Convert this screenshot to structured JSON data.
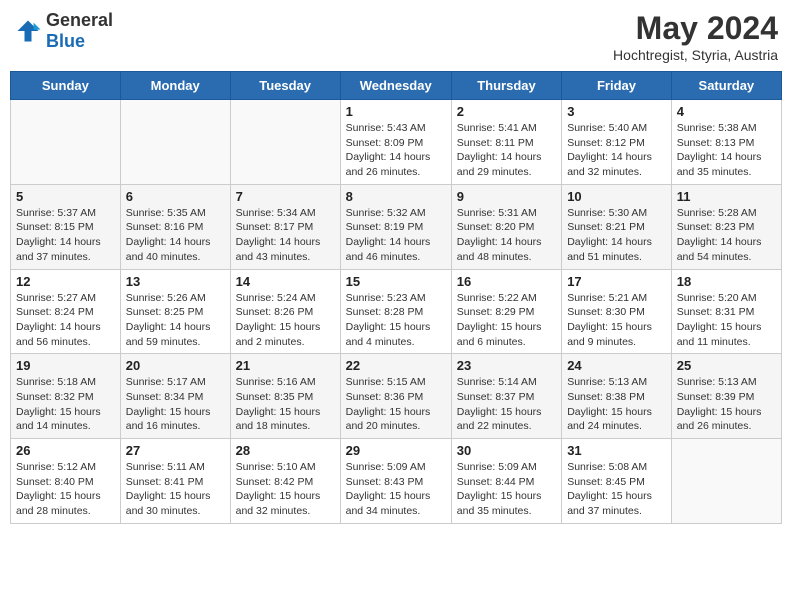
{
  "header": {
    "logo_general": "General",
    "logo_blue": "Blue",
    "month_year": "May 2024",
    "location": "Hochtregist, Styria, Austria"
  },
  "weekdays": [
    "Sunday",
    "Monday",
    "Tuesday",
    "Wednesday",
    "Thursday",
    "Friday",
    "Saturday"
  ],
  "weeks": [
    [
      {
        "day": "",
        "info": ""
      },
      {
        "day": "",
        "info": ""
      },
      {
        "day": "",
        "info": ""
      },
      {
        "day": "1",
        "info": "Sunrise: 5:43 AM\nSunset: 8:09 PM\nDaylight: 14 hours\nand 26 minutes."
      },
      {
        "day": "2",
        "info": "Sunrise: 5:41 AM\nSunset: 8:11 PM\nDaylight: 14 hours\nand 29 minutes."
      },
      {
        "day": "3",
        "info": "Sunrise: 5:40 AM\nSunset: 8:12 PM\nDaylight: 14 hours\nand 32 minutes."
      },
      {
        "day": "4",
        "info": "Sunrise: 5:38 AM\nSunset: 8:13 PM\nDaylight: 14 hours\nand 35 minutes."
      }
    ],
    [
      {
        "day": "5",
        "info": "Sunrise: 5:37 AM\nSunset: 8:15 PM\nDaylight: 14 hours\nand 37 minutes."
      },
      {
        "day": "6",
        "info": "Sunrise: 5:35 AM\nSunset: 8:16 PM\nDaylight: 14 hours\nand 40 minutes."
      },
      {
        "day": "7",
        "info": "Sunrise: 5:34 AM\nSunset: 8:17 PM\nDaylight: 14 hours\nand 43 minutes."
      },
      {
        "day": "8",
        "info": "Sunrise: 5:32 AM\nSunset: 8:19 PM\nDaylight: 14 hours\nand 46 minutes."
      },
      {
        "day": "9",
        "info": "Sunrise: 5:31 AM\nSunset: 8:20 PM\nDaylight: 14 hours\nand 48 minutes."
      },
      {
        "day": "10",
        "info": "Sunrise: 5:30 AM\nSunset: 8:21 PM\nDaylight: 14 hours\nand 51 minutes."
      },
      {
        "day": "11",
        "info": "Sunrise: 5:28 AM\nSunset: 8:23 PM\nDaylight: 14 hours\nand 54 minutes."
      }
    ],
    [
      {
        "day": "12",
        "info": "Sunrise: 5:27 AM\nSunset: 8:24 PM\nDaylight: 14 hours\nand 56 minutes."
      },
      {
        "day": "13",
        "info": "Sunrise: 5:26 AM\nSunset: 8:25 PM\nDaylight: 14 hours\nand 59 minutes."
      },
      {
        "day": "14",
        "info": "Sunrise: 5:24 AM\nSunset: 8:26 PM\nDaylight: 15 hours\nand 2 minutes."
      },
      {
        "day": "15",
        "info": "Sunrise: 5:23 AM\nSunset: 8:28 PM\nDaylight: 15 hours\nand 4 minutes."
      },
      {
        "day": "16",
        "info": "Sunrise: 5:22 AM\nSunset: 8:29 PM\nDaylight: 15 hours\nand 6 minutes."
      },
      {
        "day": "17",
        "info": "Sunrise: 5:21 AM\nSunset: 8:30 PM\nDaylight: 15 hours\nand 9 minutes."
      },
      {
        "day": "18",
        "info": "Sunrise: 5:20 AM\nSunset: 8:31 PM\nDaylight: 15 hours\nand 11 minutes."
      }
    ],
    [
      {
        "day": "19",
        "info": "Sunrise: 5:18 AM\nSunset: 8:32 PM\nDaylight: 15 hours\nand 14 minutes."
      },
      {
        "day": "20",
        "info": "Sunrise: 5:17 AM\nSunset: 8:34 PM\nDaylight: 15 hours\nand 16 minutes."
      },
      {
        "day": "21",
        "info": "Sunrise: 5:16 AM\nSunset: 8:35 PM\nDaylight: 15 hours\nand 18 minutes."
      },
      {
        "day": "22",
        "info": "Sunrise: 5:15 AM\nSunset: 8:36 PM\nDaylight: 15 hours\nand 20 minutes."
      },
      {
        "day": "23",
        "info": "Sunrise: 5:14 AM\nSunset: 8:37 PM\nDaylight: 15 hours\nand 22 minutes."
      },
      {
        "day": "24",
        "info": "Sunrise: 5:13 AM\nSunset: 8:38 PM\nDaylight: 15 hours\nand 24 minutes."
      },
      {
        "day": "25",
        "info": "Sunrise: 5:13 AM\nSunset: 8:39 PM\nDaylight: 15 hours\nand 26 minutes."
      }
    ],
    [
      {
        "day": "26",
        "info": "Sunrise: 5:12 AM\nSunset: 8:40 PM\nDaylight: 15 hours\nand 28 minutes."
      },
      {
        "day": "27",
        "info": "Sunrise: 5:11 AM\nSunset: 8:41 PM\nDaylight: 15 hours\nand 30 minutes."
      },
      {
        "day": "28",
        "info": "Sunrise: 5:10 AM\nSunset: 8:42 PM\nDaylight: 15 hours\nand 32 minutes."
      },
      {
        "day": "29",
        "info": "Sunrise: 5:09 AM\nSunset: 8:43 PM\nDaylight: 15 hours\nand 34 minutes."
      },
      {
        "day": "30",
        "info": "Sunrise: 5:09 AM\nSunset: 8:44 PM\nDaylight: 15 hours\nand 35 minutes."
      },
      {
        "day": "31",
        "info": "Sunrise: 5:08 AM\nSunset: 8:45 PM\nDaylight: 15 hours\nand 37 minutes."
      },
      {
        "day": "",
        "info": ""
      }
    ]
  ]
}
